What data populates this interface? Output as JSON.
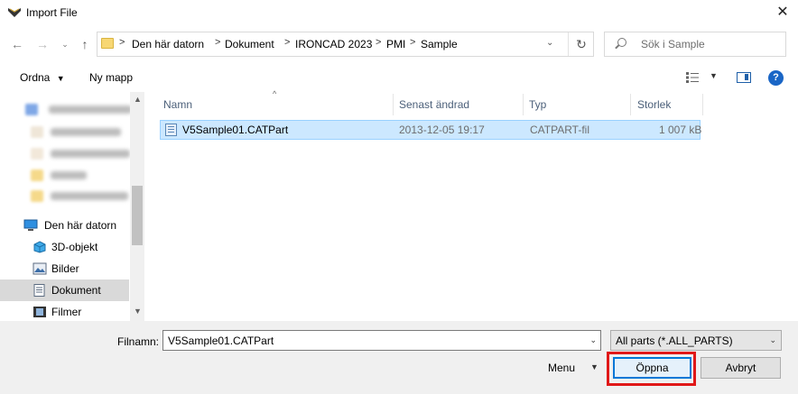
{
  "window": {
    "title": "Import File"
  },
  "address": {
    "crumbs": [
      "Den här datorn",
      "Dokument",
      "IRONCAD 2023",
      "PMI",
      "Sample"
    ]
  },
  "search": {
    "placeholder": "Sök i Sample"
  },
  "toolbar": {
    "organize": "Ordna",
    "new_folder": "Ny mapp"
  },
  "nav": {
    "pc": "Den här datorn",
    "items": [
      {
        "label": "3D-objekt",
        "icon": "3d-objects-icon"
      },
      {
        "label": "Bilder",
        "icon": "pictures-icon"
      },
      {
        "label": "Dokument",
        "icon": "documents-icon",
        "selected": true
      },
      {
        "label": "Filmer",
        "icon": "videos-icon"
      }
    ]
  },
  "columns": {
    "name": "Namn",
    "modified": "Senast ändrad",
    "type": "Typ",
    "size": "Storlek"
  },
  "files": [
    {
      "name": "V5Sample01.CATPart",
      "modified": "2013-12-05 19:17",
      "type": "CATPART-fil",
      "size": "1 007 kB",
      "selected": true
    }
  ],
  "footer": {
    "filename_label": "Filnamn:",
    "filename_value": "V5Sample01.CATPart",
    "filter": "All parts (*.ALL_PARTS)",
    "menu": "Menu",
    "open": "Öppna",
    "cancel": "Avbryt"
  },
  "colors": {
    "selection": "#cce8ff",
    "accent": "#0078d7",
    "highlight": "#e01818"
  }
}
